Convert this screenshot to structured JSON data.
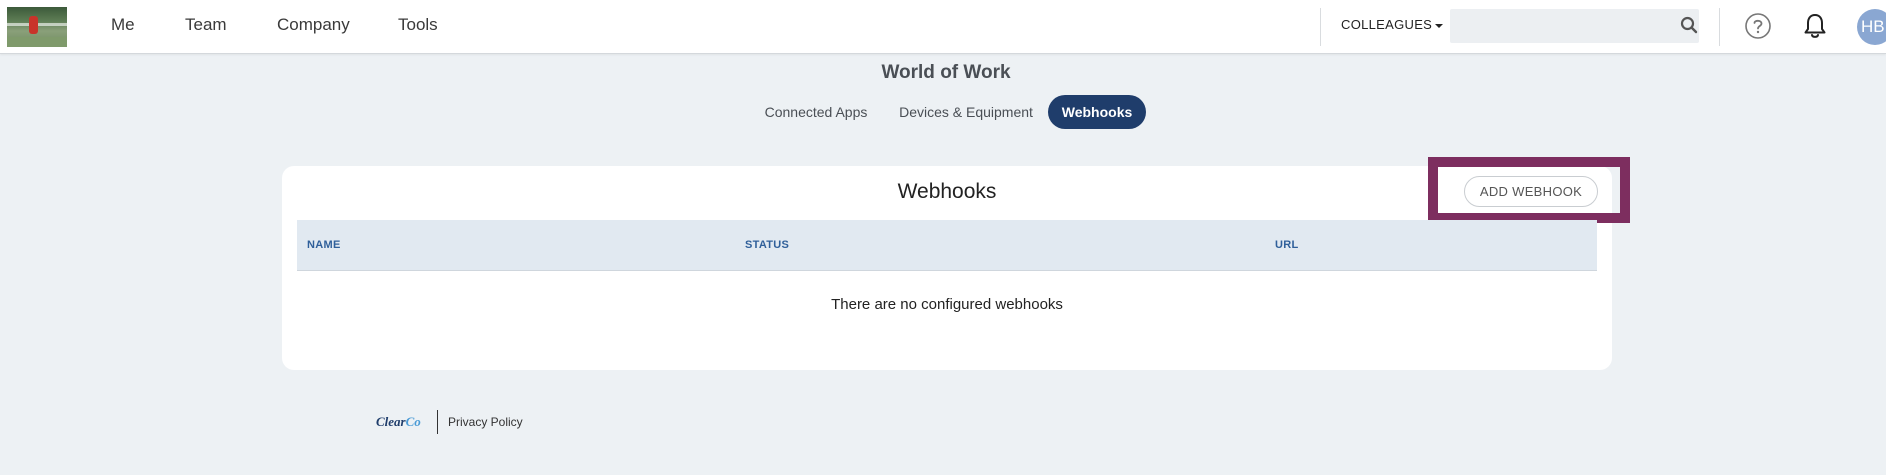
{
  "nav": {
    "items": [
      "Me",
      "Team",
      "Company",
      "Tools"
    ],
    "colleagues_label": "COLLEAGUES",
    "search_placeholder": "",
    "avatar_initials": "HB",
    "icons": {
      "search": "search-icon",
      "help": "help-icon",
      "bell": "bell-icon"
    }
  },
  "page": {
    "title": "World of Work",
    "tabs": [
      {
        "label": "Connected Apps",
        "active": false
      },
      {
        "label": "Devices & Equipment",
        "active": false
      },
      {
        "label": "Webhooks",
        "active": true
      }
    ]
  },
  "card": {
    "title": "Webhooks",
    "add_button_label": "ADD WEBHOOK",
    "columns": [
      "NAME",
      "STATUS",
      "URL"
    ],
    "empty_message": "There are no configured webhooks"
  },
  "footer": {
    "brand_main": "Clear",
    "brand_accent": "Co",
    "privacy_label": "Privacy Policy"
  },
  "colors": {
    "primary": "#1f3d6b",
    "highlight": "#7d2e5f",
    "header_text": "#2f5f9a",
    "background": "#edf1f4"
  }
}
